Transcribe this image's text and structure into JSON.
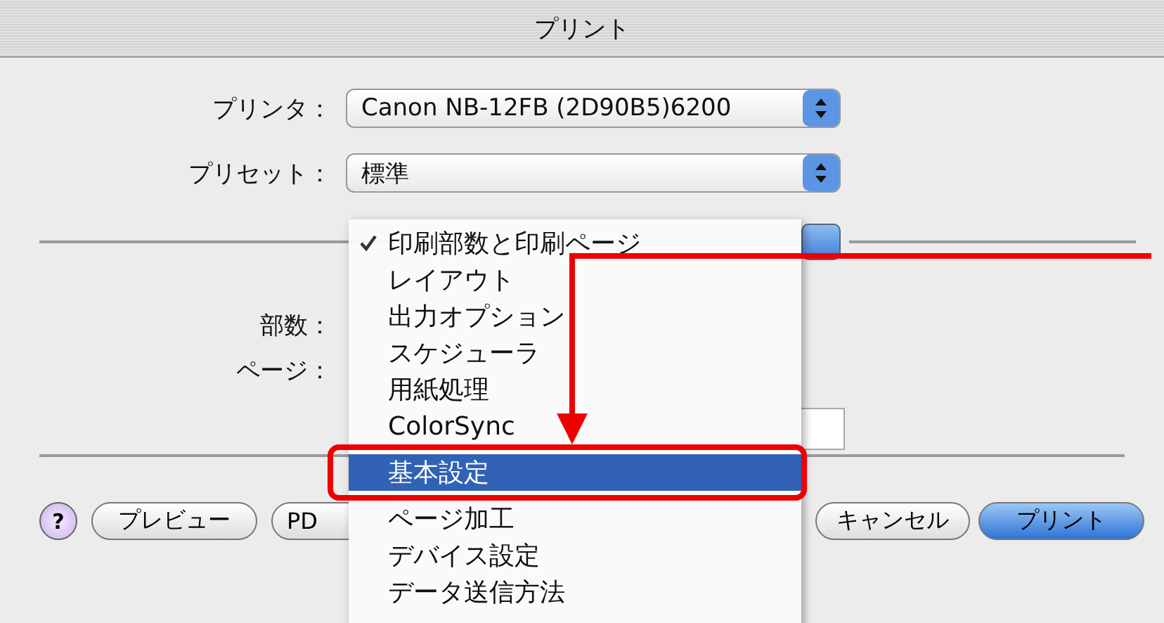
{
  "window": {
    "title": "プリント"
  },
  "fields": [
    {
      "label": "プリンタ：",
      "value": "Canon NB-12FB (2D90B5)6200"
    },
    {
      "label": "プリセット：",
      "value": "標準"
    }
  ],
  "copies": {
    "label": "部数："
  },
  "pages": {
    "label": "ページ："
  },
  "menu": {
    "items": [
      {
        "label": "印刷部数と印刷ページ",
        "checked": true,
        "selected": false
      },
      {
        "label": "レイアウト",
        "checked": false,
        "selected": false
      },
      {
        "label": "出力オプション",
        "checked": false,
        "selected": false
      },
      {
        "label": "スケジューラ",
        "checked": false,
        "selected": false
      },
      {
        "label": "用紙処理",
        "checked": false,
        "selected": false
      },
      {
        "label": "ColorSync",
        "checked": false,
        "selected": false
      },
      {
        "label": "基本設定",
        "checked": false,
        "selected": true
      },
      {
        "label": "ページ加工",
        "checked": false,
        "selected": false
      },
      {
        "label": "デバイス設定",
        "checked": false,
        "selected": false
      },
      {
        "label": "データ送信方法",
        "checked": false,
        "selected": false
      }
    ]
  },
  "buttons": [
    {
      "kind": "help",
      "label": "?"
    },
    {
      "kind": "plain",
      "label": "プレビュー"
    },
    {
      "kind": "plain",
      "label": "PD"
    },
    {
      "kind": "cancel",
      "label": "キャンセル"
    },
    {
      "kind": "default",
      "label": "プリント"
    }
  ]
}
